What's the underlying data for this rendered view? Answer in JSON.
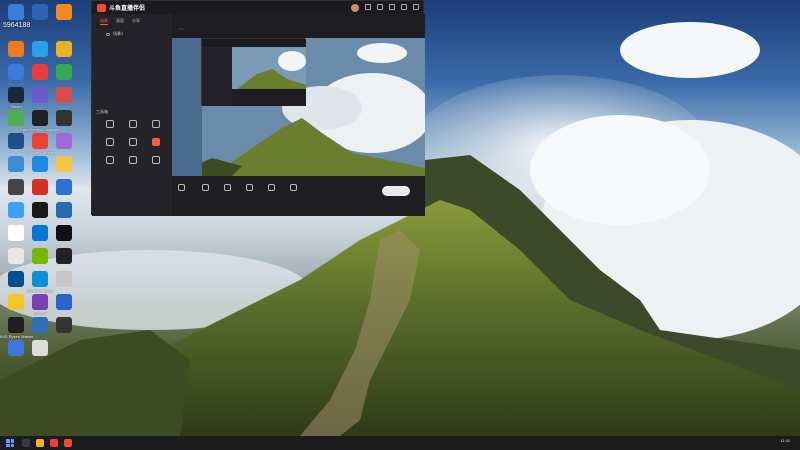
{
  "desktop": {
    "qq_id": "5964188",
    "icons": [
      {
        "label": "",
        "color": "#3b7ed8"
      },
      {
        "label": "",
        "color": "#2e63b8"
      },
      {
        "label": "",
        "color": "#f08a24"
      },
      {
        "label": "",
        "color": "#f27a1e"
      },
      {
        "label": "",
        "color": "#2aa0e8"
      },
      {
        "label": "",
        "color": "#e8b320"
      },
      {
        "label": "",
        "color": "#3a7bd5"
      },
      {
        "label": "",
        "color": "#e33d3d"
      },
      {
        "label": "",
        "color": "#34a853"
      },
      {
        "label": "Steam",
        "color": "#1b2838"
      },
      {
        "label": "",
        "color": "#6a5acd"
      },
      {
        "label": "",
        "color": "#d94c4c"
      },
      {
        "label": "",
        "color": "#4caf50"
      },
      {
        "label": "Epic Games Launcher",
        "color": "#222222"
      },
      {
        "label": "",
        "color": "#333333"
      },
      {
        "label": "",
        "color": "#1f4f8b"
      },
      {
        "label": "Google Chrome",
        "color": "#e94235"
      },
      {
        "label": "",
        "color": "#9c6ad6"
      },
      {
        "label": "",
        "color": "#3b8fd6"
      },
      {
        "label": "",
        "color": "#1e88e5"
      },
      {
        "label": "",
        "color": "#f4c542"
      },
      {
        "label": "",
        "color": "#444444"
      },
      {
        "label": "",
        "color": "#d93025"
      },
      {
        "label": "",
        "color": "#2d6fd2"
      },
      {
        "label": "",
        "color": "#3ba1ff"
      },
      {
        "label": "",
        "color": "#1a1a1a"
      },
      {
        "label": "",
        "color": "#2b6cb0"
      },
      {
        "label": "",
        "color": "#ffffff"
      },
      {
        "label": "",
        "color": "#0078d7"
      },
      {
        "label": "",
        "color": "#111111"
      },
      {
        "label": "",
        "color": "#e6e6e6"
      },
      {
        "label": "",
        "color": "#76b900"
      },
      {
        "label": "",
        "color": "#222222"
      },
      {
        "label": "",
        "color": "#0a4d8c"
      },
      {
        "label": "Microsoft Edge",
        "color": "#0c8ed9"
      },
      {
        "label": "",
        "color": "#c7c7c7"
      },
      {
        "label": "",
        "color": "#f3c623"
      },
      {
        "label": "CPU-Z",
        "color": "#7a3fb0"
      },
      {
        "label": "",
        "color": "#2a65c9"
      },
      {
        "label": "AMD Ryzen Master",
        "color": "#1e1e1e"
      },
      {
        "label": "",
        "color": "#2f6fb6"
      },
      {
        "label": "",
        "color": "#333333"
      },
      {
        "label": "",
        "color": "#3c78d8"
      },
      {
        "label": "",
        "color": "#dcdcdc"
      }
    ]
  },
  "app": {
    "name": "斗鱼直播伴侣",
    "version": "",
    "left_tabs": [
      "场景",
      "画面",
      "分享"
    ],
    "scene_label": "场景1",
    "tools_title": "工具箱",
    "tools": [
      {
        "label": "",
        "hot": false
      },
      {
        "label": "",
        "hot": false
      },
      {
        "label": "",
        "hot": false
      },
      {
        "label": "",
        "hot": false
      },
      {
        "label": "",
        "hot": false
      },
      {
        "label": "",
        "hot": true
      },
      {
        "label": "",
        "hot": false
      },
      {
        "label": "",
        "hot": false
      },
      {
        "label": "",
        "hot": false
      }
    ],
    "room_title": "",
    "room_btn": "",
    "room_tag": "",
    "room_tag2": "",
    "bottom_buttons": [
      "",
      "",
      "",
      "",
      "",
      ""
    ],
    "status_text": ""
  },
  "taskbar": {
    "tray_cpu": "",
    "tray_gpu": "",
    "time": "11:11",
    "date": ""
  }
}
